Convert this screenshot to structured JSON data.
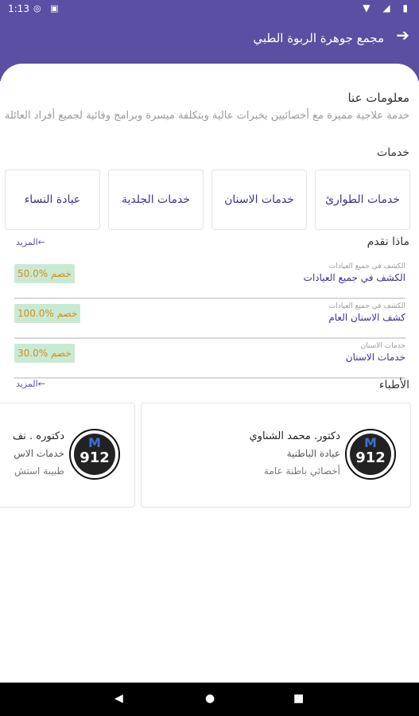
{
  "status_bar": {
    "time": "1:13",
    "left_icons": "◎ ▣",
    "right_icons": "▼ ◢ ▮"
  },
  "app_bar": {
    "title": "مجمع جوهرة الربوة الطبي",
    "back_icon": "arrow-back-icon",
    "back_glyph": "➔"
  },
  "about": {
    "title": "معلومات عنا",
    "text": "خدمة علاجية مميزة مع أخصائيين بخبرات عالية وبتكلفة ميسرة وبرامج وقائية لجميع أفراد العائلة"
  },
  "services": {
    "title": "خدمات",
    "items": [
      "خدمات الطوارئ",
      "خدمات الاسنان",
      "خدمات الجلدية",
      "عيادة النساء"
    ]
  },
  "what_we_offer": {
    "title": "ماذا نقدم",
    "more": "المزيد←",
    "items": [
      {
        "category": "الكشف في جميع العيادات",
        "name": "الكشف في جميع العيادات",
        "discount": "50.0% خصم"
      },
      {
        "category": "الكشف في جميع العيادات",
        "name": "كشف الاسنان العام",
        "discount": "100.0% خصم"
      },
      {
        "category": "خدمات الاسنان",
        "name": "خدمات الاسنان",
        "discount": "30.0% خصم"
      }
    ]
  },
  "doctors": {
    "title": "الأطباء",
    "more": "المزيد←",
    "items": [
      {
        "name": "دكتور. محمد الشناوي",
        "specialty": "عيادة الباطنية",
        "title": "أخصائي باطنة عامة",
        "logo_text": "912"
      },
      {
        "name": "دكتوره . نف",
        "specialty": "خدمات الاس",
        "title": "طبيبة استش",
        "logo_text": "912"
      }
    ]
  },
  "nav_bar": {
    "back": "◀",
    "home": "●",
    "recent": "■"
  },
  "colors": {
    "primary": "#5a4fa3",
    "accent_text": "#3b3592",
    "badge_bg": "#c9ead2",
    "badge_text": "#d38d1f"
  }
}
